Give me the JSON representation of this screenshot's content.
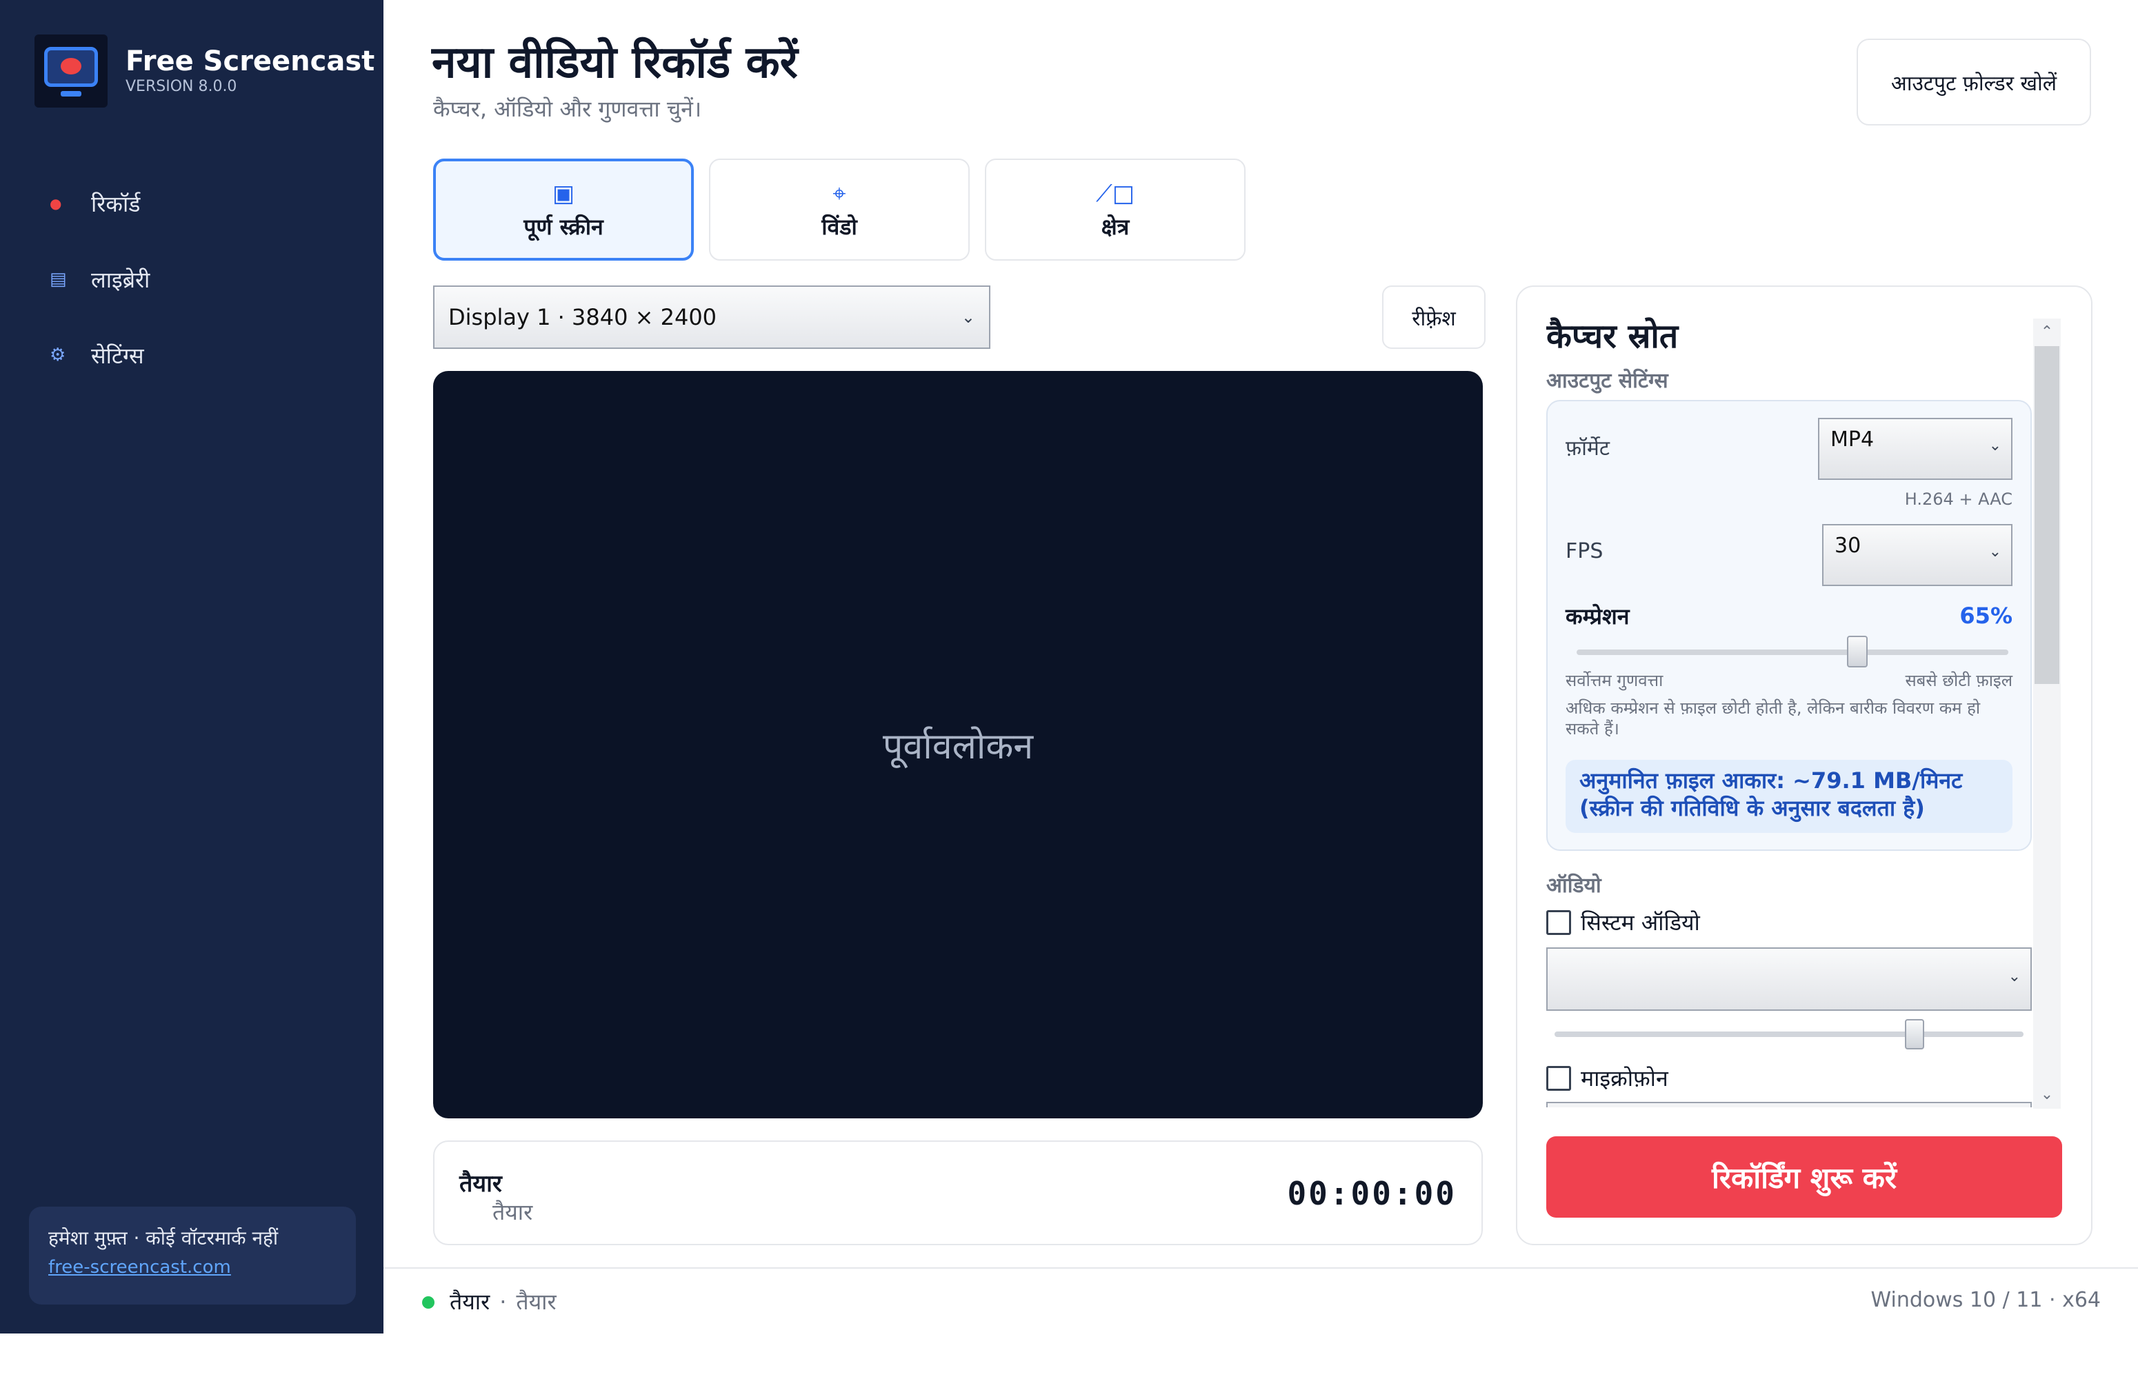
{
  "sidebar": {
    "brand_title": "Free Screencast",
    "brand_version": "VERSION 8.0.0",
    "items": [
      {
        "label": "रिकॉर्ड",
        "icon": "record-dot-icon"
      },
      {
        "label": "लाइब्रेरी",
        "icon": "library-icon"
      },
      {
        "label": "सेटिंग्स",
        "icon": "gear-icon"
      }
    ],
    "footer_text": "हमेशा मुफ़्त · कोई वॉटरमार्क नहीं",
    "footer_link": "free-screencast.com"
  },
  "header": {
    "title": "नया वीडियो रिकॉर्ड करें",
    "subtitle": "कैप्चर, ऑडियो और गुणवत्ता चुनें।",
    "open_folder": "आउटपुट फ़ोल्डर खोलें"
  },
  "modes": [
    {
      "label": "पूर्ण स्क्रीन",
      "icon": "fullscreen-icon",
      "active": true
    },
    {
      "label": "विंडो",
      "icon": "crosshair-icon",
      "active": false
    },
    {
      "label": "क्षेत्र",
      "icon": "region-icon",
      "active": false
    }
  ],
  "display_select": {
    "value": "Display 1  ·  3840 × 2400"
  },
  "refresh_label": "रीफ़्रेश",
  "preview_label": "पूर्वावलोकन",
  "status_card": {
    "title": "तैयार",
    "sub": "तैयार",
    "timer": "00:00:00"
  },
  "panel": {
    "title": "कैप्चर स्रोत",
    "output_label": "आउटपुट सेटिंग्स",
    "format_label": "फ़ॉर्मेट",
    "format_value": "MP4",
    "format_hint": "H.264 + AAC",
    "fps_label": "FPS",
    "fps_value": "30",
    "compression_label": "कम्प्रेशन",
    "compression_value": "65%",
    "compression_level": 0.65,
    "compression_min": "सर्वोत्तम गुणवत्ता",
    "compression_max": "सबसे छोटी फ़ाइल",
    "compression_note": "अधिक कम्प्रेशन से फ़ाइल छोटी होती है, लेकिन बारीक विवरण कम हो सकते हैं।",
    "estimate": "अनुमानित फ़ाइल आकार: ~79.1 MB/मिनट (स्क्रीन की गतिविधि के अनुसार बदलता है)",
    "audio_label": "ऑडियो",
    "system_audio_label": "सिस्टम ऑडियो",
    "system_audio_checked": false,
    "system_audio_volume": 0.8,
    "mic_label": "माइक्रोफ़ोन",
    "mic_checked": false,
    "record_button": "रिकॉर्डिंग शुरू करें"
  },
  "statusbar": {
    "state": "तैयार",
    "state_sub": "तैयार",
    "system": "Windows 10 / 11  ·  x64"
  },
  "colors": {
    "accent": "#3b82f6",
    "record": "#f0414f",
    "sidebar": "#172545",
    "ready": "#22c55e"
  }
}
